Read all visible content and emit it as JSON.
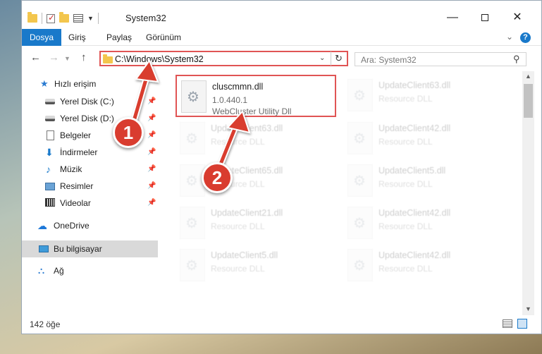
{
  "window": {
    "title": "System32",
    "minimize_glyph": "—",
    "close_glyph": "✕"
  },
  "ribbon": {
    "tabs": [
      {
        "label": "Dosya"
      },
      {
        "label": "Giriş"
      },
      {
        "label": "Paylaş"
      },
      {
        "label": "Görünüm"
      }
    ],
    "help_glyph": "?"
  },
  "navigation": {
    "back_glyph": "←",
    "forward_glyph": "→",
    "up_glyph": "↑",
    "address": "C:\\Windows\\System32",
    "search_placeholder": "Ara: System32"
  },
  "sidebar": {
    "items": [
      {
        "label": "Hızlı erişim",
        "icon": "quick-access-star-icon"
      },
      {
        "label": "Yerel Disk (C:)",
        "icon": "drive-icon",
        "pinned": true
      },
      {
        "label": "Yerel Disk (D:)",
        "icon": "drive-icon",
        "pinned": true
      },
      {
        "label": "Belgeler",
        "icon": "documents-icon",
        "pinned": true
      },
      {
        "label": "İndirmeler",
        "icon": "downloads-icon",
        "pinned": true
      },
      {
        "label": "Müzik",
        "icon": "music-icon",
        "pinned": true
      },
      {
        "label": "Resimler",
        "icon": "pictures-icon",
        "pinned": true
      },
      {
        "label": "Videolar",
        "icon": "videos-icon",
        "pinned": true
      },
      {
        "label": "OneDrive",
        "icon": "onedrive-icon"
      },
      {
        "label": "Bu bilgisayar",
        "icon": "this-pc-icon",
        "selected": true
      },
      {
        "label": "Ağ",
        "icon": "network-icon"
      }
    ]
  },
  "files": [
    {
      "name": "cluscmmn.dll",
      "line1": "1.0.440.1",
      "line2": "WebCluster Utility Dll",
      "highlighted": true
    },
    {
      "name": "UpdateClient63.dll",
      "line1": "Resource DLL"
    },
    {
      "name": "UpdateClient63.dll",
      "line1": "Resource DLL"
    },
    {
      "name": "UpdateClient42.dll",
      "line1": "Resource DLL"
    },
    {
      "name": "UpdateClient65.dll",
      "line1": "Resource DLL"
    },
    {
      "name": "UpdateClient5.dll",
      "line1": "Resource DLL"
    },
    {
      "name": "UpdateClient21.dll",
      "line1": "Resource DLL"
    },
    {
      "name": "UpdateClient42.dll",
      "line1": "Resource DLL"
    },
    {
      "name": "UpdateClient5.dll",
      "line1": "Resource DLL"
    },
    {
      "name": "UpdateClient42.dll",
      "line1": "Resource DLL"
    }
  ],
  "status": {
    "item_count": "142 öğe"
  },
  "annotations": {
    "marker1": "1",
    "marker2": "2",
    "color": "#d93c2f"
  },
  "colors": {
    "accent": "#1979ca",
    "highlight_border": "#e05454"
  }
}
